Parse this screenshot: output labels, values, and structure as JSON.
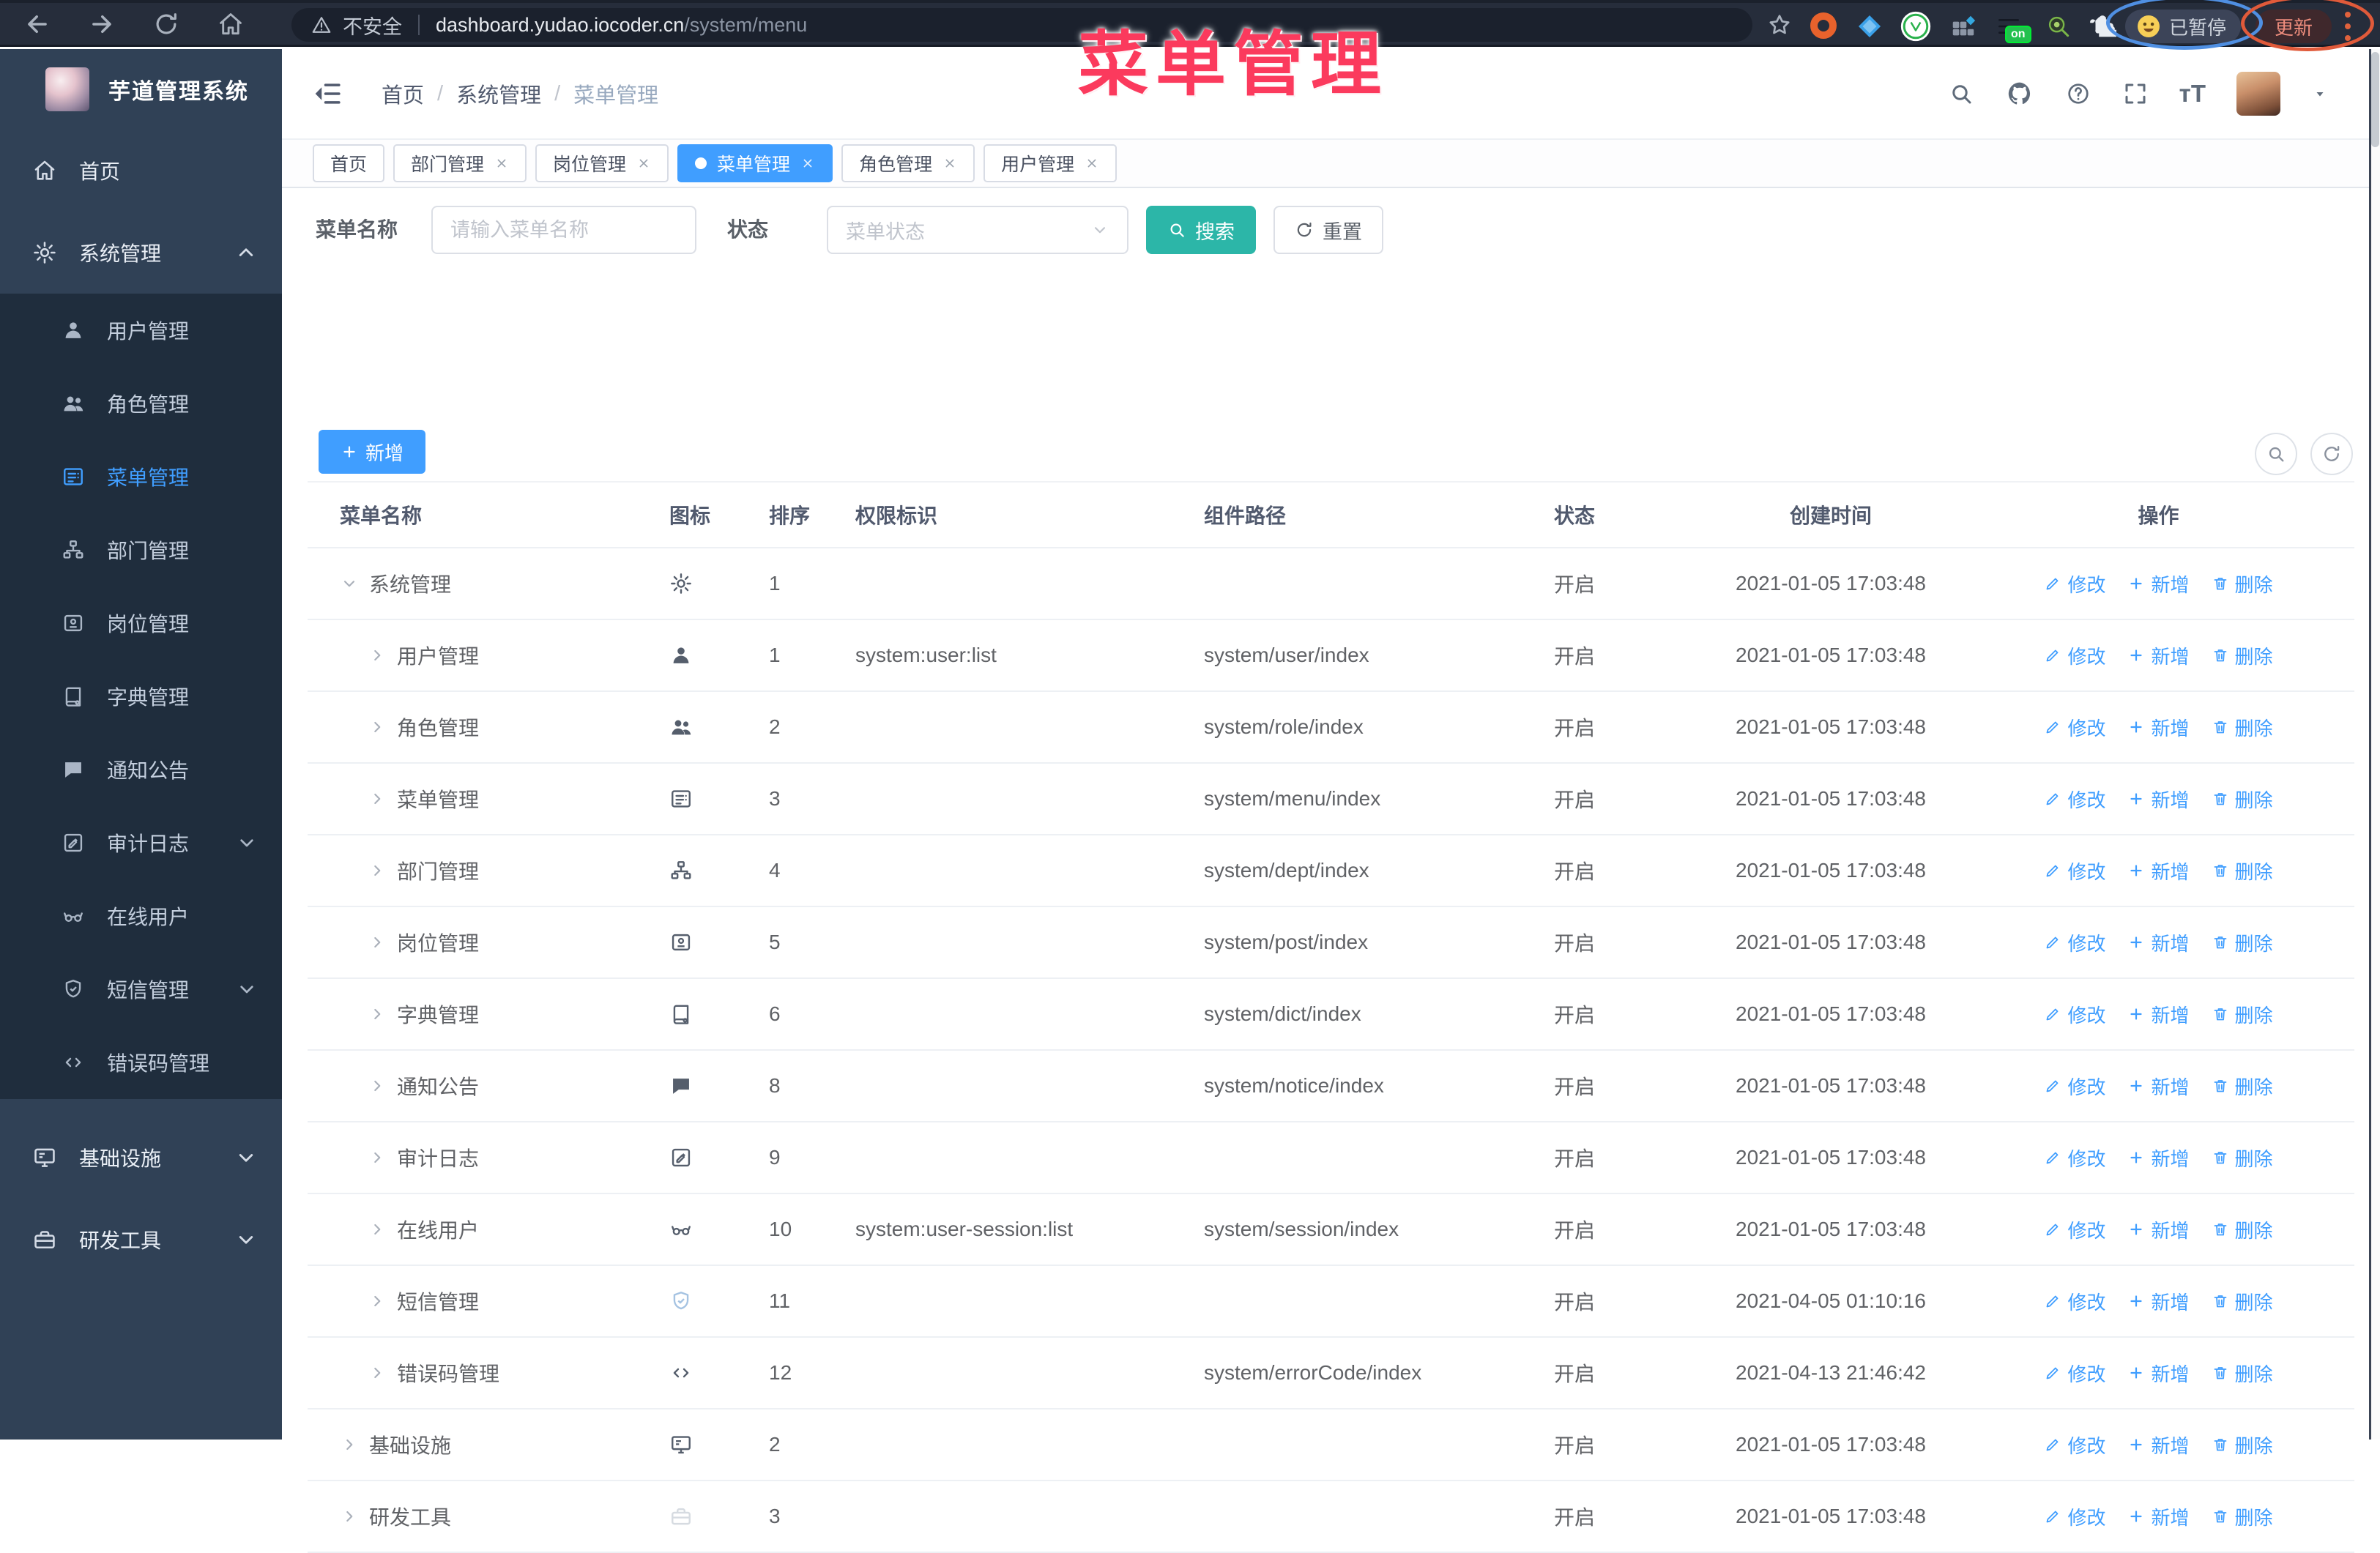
{
  "annotation": {
    "title": "菜单管理",
    "color": "#fb3a5d"
  },
  "browser": {
    "security_label": "不安全",
    "url_host": "dashboard.yudao.iocoder.cn",
    "url_path": "/system/menu",
    "profile_badge": "已暂停",
    "update_label": "更新",
    "extension_icons": [
      "bookmark-star",
      "orange-donut",
      "blue-diamond",
      "green-check-circle",
      "grid-apps",
      "tabs-on-badge",
      "green-magnifier",
      "puzzle-piece"
    ],
    "nav_icons": [
      "back",
      "forward",
      "reload",
      "home"
    ]
  },
  "sidebar": {
    "app_title": "芋道管理系统",
    "items": [
      {
        "key": "home",
        "icon": "home",
        "label": "首页"
      },
      {
        "key": "system",
        "icon": "gear",
        "label": "系统管理",
        "expanded": true,
        "children": [
          {
            "key": "user-mgmt",
            "icon": "user",
            "label": "用户管理"
          },
          {
            "key": "role-mgmt",
            "icon": "users",
            "label": "角色管理"
          },
          {
            "key": "menu-mgmt",
            "icon": "menu",
            "label": "菜单管理",
            "active": true
          },
          {
            "key": "dept-mgmt",
            "icon": "tree",
            "label": "部门管理"
          },
          {
            "key": "post-mgmt",
            "icon": "badge",
            "label": "岗位管理"
          },
          {
            "key": "dict-mgmt",
            "icon": "book",
            "label": "字典管理"
          },
          {
            "key": "notice",
            "icon": "chat",
            "label": "通知公告"
          },
          {
            "key": "audit-log",
            "icon": "log",
            "label": "审计日志",
            "chevron": "down"
          },
          {
            "key": "online-user",
            "icon": "glasses",
            "label": "在线用户"
          },
          {
            "key": "sms-mgmt",
            "icon": "shield",
            "label": "短信管理",
            "chevron": "down"
          },
          {
            "key": "errcode-mgmt",
            "icon": "code",
            "label": "错误码管理"
          }
        ]
      },
      {
        "key": "infra",
        "icon": "monitor",
        "label": "基础设施",
        "chevron": "down"
      },
      {
        "key": "devtool",
        "icon": "toolbox",
        "label": "研发工具",
        "chevron": "down"
      }
    ]
  },
  "header": {
    "breadcrumb": [
      "首页",
      "系统管理",
      "菜单管理"
    ],
    "right_icons": [
      "search",
      "github",
      "question",
      "fullscreen",
      "font-size",
      "avatar",
      "caret-down"
    ]
  },
  "tabs": [
    {
      "key": "home",
      "label": "首页",
      "closable": false,
      "active": false
    },
    {
      "key": "dept",
      "label": "部门管理",
      "closable": true,
      "active": false
    },
    {
      "key": "post",
      "label": "岗位管理",
      "closable": true,
      "active": false
    },
    {
      "key": "menu",
      "label": "菜单管理",
      "closable": true,
      "active": true
    },
    {
      "key": "role",
      "label": "角色管理",
      "closable": true,
      "active": false
    },
    {
      "key": "user",
      "label": "用户管理",
      "closable": true,
      "active": false
    }
  ],
  "filters": {
    "name_label": "菜单名称",
    "name_placeholder": "请输入菜单名称",
    "status_label": "状态",
    "status_placeholder": "菜单状态",
    "search_label": "搜索",
    "reset_label": "重置",
    "add_label": "新增"
  },
  "table": {
    "headers": [
      "菜单名称",
      "图标",
      "排序",
      "权限标识",
      "组件路径",
      "状态",
      "创建时间",
      "操作"
    ],
    "actions": {
      "edit": "修改",
      "add": "新增",
      "delete": "删除"
    },
    "rows": [
      {
        "level": 0,
        "caret": "expanded",
        "name": "系统管理",
        "icon": "gear",
        "tone": "dark",
        "sort": "1",
        "perm": "",
        "path": "",
        "status": "开启",
        "time": "2021-01-05 17:03:48"
      },
      {
        "level": 1,
        "caret": "collapsed",
        "name": "用户管理",
        "icon": "user",
        "tone": "dark",
        "sort": "1",
        "perm": "system:user:list",
        "path": "system/user/index",
        "status": "开启",
        "time": "2021-01-05 17:03:48"
      },
      {
        "level": 1,
        "caret": "collapsed",
        "name": "角色管理",
        "icon": "users",
        "tone": "dark",
        "sort": "2",
        "perm": "",
        "path": "system/role/index",
        "status": "开启",
        "time": "2021-01-05 17:03:48"
      },
      {
        "level": 1,
        "caret": "collapsed",
        "name": "菜单管理",
        "icon": "menu",
        "tone": "dark",
        "sort": "3",
        "perm": "",
        "path": "system/menu/index",
        "status": "开启",
        "time": "2021-01-05 17:03:48"
      },
      {
        "level": 1,
        "caret": "collapsed",
        "name": "部门管理",
        "icon": "tree",
        "tone": "dark",
        "sort": "4",
        "perm": "",
        "path": "system/dept/index",
        "status": "开启",
        "time": "2021-01-05 17:03:48"
      },
      {
        "level": 1,
        "caret": "collapsed",
        "name": "岗位管理",
        "icon": "badge",
        "tone": "dark",
        "sort": "5",
        "perm": "",
        "path": "system/post/index",
        "status": "开启",
        "time": "2021-01-05 17:03:48"
      },
      {
        "level": 1,
        "caret": "collapsed",
        "name": "字典管理",
        "icon": "book",
        "tone": "dark",
        "sort": "6",
        "perm": "",
        "path": "system/dict/index",
        "status": "开启",
        "time": "2021-01-05 17:03:48"
      },
      {
        "level": 1,
        "caret": "collapsed",
        "name": "通知公告",
        "icon": "chat",
        "tone": "dark",
        "sort": "8",
        "perm": "",
        "path": "system/notice/index",
        "status": "开启",
        "time": "2021-01-05 17:03:48"
      },
      {
        "level": 1,
        "caret": "collapsed",
        "name": "审计日志",
        "icon": "log",
        "tone": "dark",
        "sort": "9",
        "perm": "",
        "path": "",
        "status": "开启",
        "time": "2021-01-05 17:03:48"
      },
      {
        "level": 1,
        "caret": "collapsed",
        "name": "在线用户",
        "icon": "glasses",
        "tone": "dark",
        "sort": "10",
        "perm": "system:user-session:list",
        "path": "system/session/index",
        "status": "开启",
        "time": "2021-01-05 17:03:48"
      },
      {
        "level": 1,
        "caret": "collapsed",
        "name": "短信管理",
        "icon": "shield",
        "tone": "light",
        "sort": "11",
        "perm": "",
        "path": "",
        "status": "开启",
        "time": "2021-04-05 01:10:16"
      },
      {
        "level": 1,
        "caret": "collapsed",
        "name": "错误码管理",
        "icon": "code",
        "tone": "dark",
        "sort": "12",
        "perm": "",
        "path": "system/errorCode/index",
        "status": "开启",
        "time": "2021-04-13 21:46:42"
      },
      {
        "level": 0,
        "caret": "collapsed",
        "name": "基础设施",
        "icon": "monitor",
        "tone": "dark",
        "sort": "2",
        "perm": "",
        "path": "",
        "status": "开启",
        "time": "2021-01-05 17:03:48"
      },
      {
        "level": 0,
        "caret": "collapsed",
        "name": "研发工具",
        "icon": "toolbox",
        "tone": "faint",
        "sort": "3",
        "perm": "",
        "path": "",
        "status": "开启",
        "time": "2021-01-05 17:03:48"
      }
    ]
  },
  "colors": {
    "accent_blue": "#409eff",
    "search_teal": "#2cb6a8",
    "sidebar_bg": "#304156",
    "sidebar_submenu_bg": "#1f2d3d",
    "annotation_pink": "#fb3a5d",
    "annotation_blue_oval": "#4f8fe2",
    "annotation_red_oval": "#e05a3a"
  }
}
